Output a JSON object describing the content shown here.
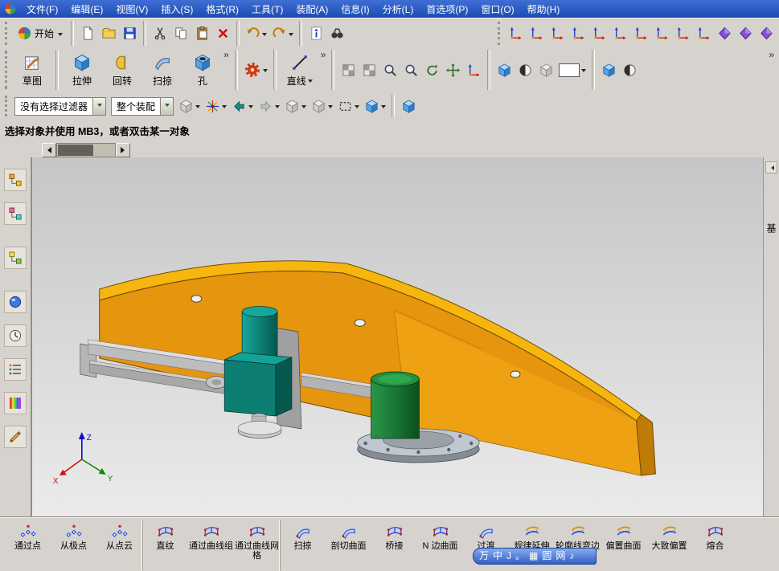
{
  "app": {
    "menu_items": [
      "文件(F)",
      "编辑(E)",
      "视图(V)",
      "插入(S)",
      "格式(R)",
      "工具(T)",
      "装配(A)",
      "信息(I)",
      "分析(L)",
      "首选项(P)",
      "窗口(O)",
      "帮助(H)"
    ]
  },
  "toolbar_main": {
    "start_label": "开始",
    "file_tools": [
      {
        "name": "new-file-button",
        "sym": "page"
      },
      {
        "name": "open-file-button",
        "sym": "folder"
      },
      {
        "name": "save-button",
        "sym": "floppy"
      }
    ],
    "edit_tools": [
      {
        "name": "cut-button",
        "sym": "cut"
      },
      {
        "name": "copy-button",
        "sym": "copy"
      },
      {
        "name": "paste-button",
        "sym": "paste"
      },
      {
        "name": "delete-button",
        "sym": "xmark"
      }
    ],
    "undo_tools": [
      {
        "name": "undo-button",
        "sym": "undo"
      },
      {
        "name": "redo-button",
        "sym": "redo"
      }
    ],
    "find_tools": [
      {
        "name": "info-button",
        "sym": "info"
      },
      {
        "name": "find-button",
        "sym": "binoc"
      }
    ],
    "right_icons": [
      {
        "name": "snap-point-icon",
        "sym": "axis"
      },
      {
        "name": "datum-axis-icon",
        "sym": "axis"
      },
      {
        "name": "datum-plane-icon",
        "sym": "axis"
      },
      {
        "name": "datum-csys-icon",
        "sym": "axis"
      },
      {
        "name": "point-constructor-icon",
        "sym": "axis"
      },
      {
        "name": "wcs-origin-icon",
        "sym": "axis"
      },
      {
        "name": "wcs-rotate-icon",
        "sym": "axis"
      },
      {
        "name": "wcs-orient-icon",
        "sym": "axis"
      },
      {
        "name": "vector-constructor-icon",
        "sym": "axis"
      },
      {
        "name": "plane-constructor-icon",
        "sym": "axis"
      },
      {
        "name": "measure-distance-icon",
        "sym": "diamond"
      },
      {
        "name": "measure-angle-icon",
        "sym": "diamond"
      },
      {
        "name": "scale-icon",
        "sym": "diamond"
      }
    ]
  },
  "feature_toolbar": {
    "sketch_label": "草图",
    "extrude_label": "拉伸",
    "revolve_label": "回转",
    "sweep_label": "扫掠",
    "hole_label": "孔",
    "line_label": "直线",
    "view_tools": [
      {
        "name": "fit-window-icon",
        "sym": "checker"
      },
      {
        "name": "adjust-view-icon",
        "sym": "checker"
      },
      {
        "name": "zoom-window-icon",
        "sym": "loupe"
      },
      {
        "name": "zoom-in-out-icon",
        "sym": "loupe"
      },
      {
        "name": "rotate-view-icon",
        "sym": "rotate"
      },
      {
        "name": "pan-view-icon",
        "sym": "pan"
      },
      {
        "name": "wcs-dynamics-icon",
        "sym": "axis"
      }
    ],
    "render_tools": [
      {
        "name": "isometric-view-icon",
        "sym": "cube"
      },
      {
        "name": "shaded-display-icon",
        "sym": "sphere"
      },
      {
        "name": "wireframe-display-icon",
        "sym": "ghostcube"
      }
    ],
    "trailing_tools": [
      {
        "name": "shaded-with-edges-icon",
        "sym": "cube"
      },
      {
        "name": "face-analysis-icon",
        "sym": "sphere"
      }
    ]
  },
  "selection_bar": {
    "filter_value": "没有选择过滤器",
    "scope_value": "整个装配",
    "tools": [
      {
        "name": "type-filter-icon",
        "sym": "ghostcube"
      },
      {
        "name": "snap-point-menu-icon",
        "sym": "star"
      },
      {
        "name": "previous-selection-icon",
        "sym": "arrowl"
      },
      {
        "name": "next-selection-icon",
        "sym": "arrowr"
      },
      {
        "name": "highlight-hidden-edges-icon",
        "sym": "ghostcube"
      },
      {
        "name": "show-hide-icon",
        "sym": "ghostcube"
      },
      {
        "name": "marquee-select-icon",
        "sym": "marquee"
      },
      {
        "name": "work-view-icon",
        "sym": "cube"
      }
    ]
  },
  "prompt_bar": {
    "text": "选择对象并使用 MB3，或者双击某一对象"
  },
  "resource_bar": {
    "tabs": [
      {
        "name": "assembly-navigator-icon",
        "sym": "tree-o"
      },
      {
        "name": "constraint-navigator-icon",
        "sym": "tree-p"
      },
      {
        "name": "part-navigator-icon",
        "sym": "tree-y"
      },
      {
        "name": "reuse-library-icon",
        "sym": "ball"
      },
      {
        "name": "history-icon",
        "sym": "clock"
      },
      {
        "name": "details-panel-icon",
        "sym": "list"
      },
      {
        "name": "palette-icon",
        "sym": "palette"
      },
      {
        "name": "roles-icon",
        "sym": "pencil"
      }
    ]
  },
  "viewport": {
    "axes": {
      "x": "X",
      "y": "Y",
      "z": "Z"
    }
  },
  "right_panel": {
    "label": "基"
  },
  "bottom_toolbar": {
    "items": [
      {
        "name": "through-points-button",
        "label": "通过点",
        "sym": "surfpts"
      },
      {
        "name": "from-poles-button",
        "label": "从极点",
        "sym": "surfpts"
      },
      {
        "name": "from-point-cloud-button",
        "label": "从点云",
        "sym": "surfpts"
      },
      {
        "name": "ruled-button",
        "label": "直纹",
        "sym": "surfmesh"
      },
      {
        "name": "through-curves-button",
        "label": "通过曲线组",
        "sym": "surfmesh"
      },
      {
        "name": "through-curve-mesh-button",
        "label": "通过曲线网格",
        "sym": "surfmesh"
      },
      {
        "name": "swept-button",
        "label": "扫掠",
        "sym": "surfswept"
      },
      {
        "name": "section-surface-button",
        "label": "剖切曲面",
        "sym": "surfswept"
      },
      {
        "name": "bridge-button",
        "label": "桥接",
        "sym": "surfmesh"
      },
      {
        "name": "n-sided-surface-button",
        "label": "N 边曲面",
        "sym": "surfmesh"
      },
      {
        "name": "transition-button",
        "label": "过渡",
        "sym": "surfswept"
      },
      {
        "name": "law-extension-button",
        "label": "规律延伸",
        "sym": "surfoffset"
      },
      {
        "name": "silhouette-flange-button",
        "label": "轮廓线弯边",
        "sym": "surfoffset"
      },
      {
        "name": "offset-surface-button",
        "label": "偏置曲面",
        "sym": "surfoffset"
      },
      {
        "name": "rough-offset-button",
        "label": "大致偏置",
        "sym": "surfoffset"
      },
      {
        "name": "fuse-button",
        "label": "熔合",
        "sym": "surfmesh"
      }
    ]
  },
  "ime_bar": {
    "items": [
      {
        "name": "ime-logo",
        "glyph": "万"
      },
      {
        "name": "ime-lang-mode",
        "glyph": "中"
      },
      {
        "name": "ime-shape-mode",
        "glyph": "J"
      },
      {
        "name": "ime-punct-mode",
        "glyph": "。"
      },
      {
        "name": "ime-softkeyboard-icon",
        "glyph": "▦"
      },
      {
        "name": "ime-fullhalf-mode",
        "glyph": "圆"
      },
      {
        "name": "ime-net-mode",
        "glyph": "网"
      },
      {
        "name": "ime-sound-icon",
        "glyph": "♪"
      }
    ]
  }
}
